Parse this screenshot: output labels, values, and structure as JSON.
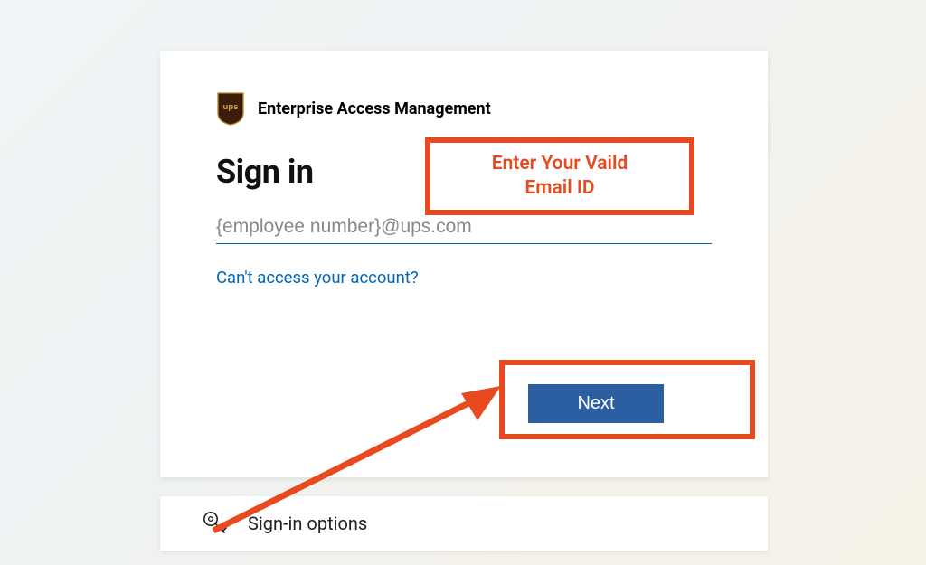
{
  "brand": {
    "logo_name": "ups-logo",
    "title": "Enterprise Access Management"
  },
  "signin": {
    "heading": "Sign in",
    "email_placeholder": "{employee number}@ups.com",
    "access_link": "Can't access your account?",
    "next_button": "Next"
  },
  "options": {
    "label": "Sign-in options"
  },
  "annotations": {
    "email_callout": "Enter Your Vaild\nEmail ID",
    "annotation_color": "#e84a1f"
  }
}
